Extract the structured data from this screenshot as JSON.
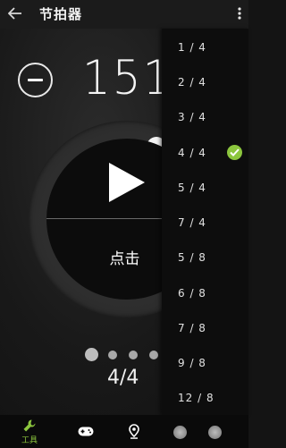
{
  "appbar": {
    "back_icon": "arrow-left-icon",
    "title": "节拍器",
    "overflow_icon": "more-vert-icon"
  },
  "metronome": {
    "bpm": "151",
    "tap_label": "点击",
    "time_signature": "4/4",
    "beats_visible": 4,
    "current_beat": 1
  },
  "menu": {
    "items": [
      {
        "label": "1 / 4",
        "selected": false
      },
      {
        "label": "2 / 4",
        "selected": false
      },
      {
        "label": "3 / 4",
        "selected": false
      },
      {
        "label": "4 / 4",
        "selected": true
      },
      {
        "label": "5 / 4",
        "selected": false
      },
      {
        "label": "7 / 4",
        "selected": false
      },
      {
        "label": "5 / 8",
        "selected": false
      },
      {
        "label": "6 / 8",
        "selected": false
      },
      {
        "label": "7 / 8",
        "selected": false
      },
      {
        "label": "9 / 8",
        "selected": false
      },
      {
        "label": "12 / 8",
        "selected": false
      }
    ]
  },
  "bottomnav": {
    "tools_label": "工具",
    "tools_icon": "wrench-icon",
    "gamepad_icon": "gamepad-icon",
    "location_icon": "location-pin-icon"
  },
  "colors": {
    "accent": "#8cc63e",
    "background": "#141414"
  }
}
